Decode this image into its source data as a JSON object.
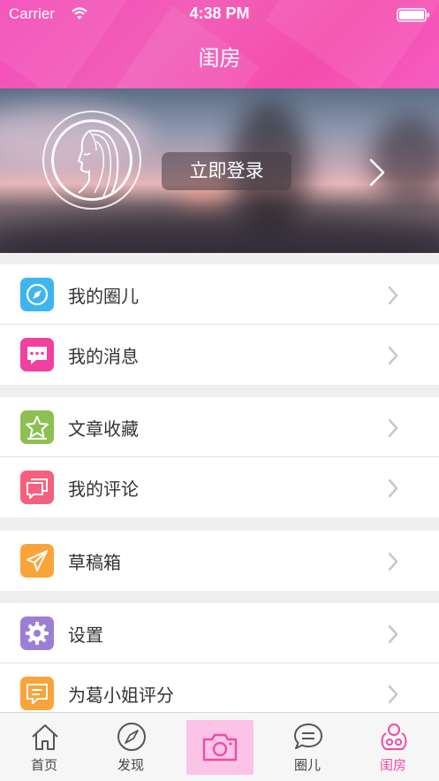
{
  "status_bar": {
    "carrier": "Carrier",
    "time": "4:38 PM"
  },
  "header": {
    "title": "闺房"
  },
  "profile": {
    "login_label": "立即登录"
  },
  "menu_groups": [
    {
      "items": [
        {
          "label": "我的圈儿",
          "icon": "compass-icon",
          "color": "#3fb5f0"
        },
        {
          "label": "我的消息",
          "icon": "message-icon",
          "color": "#f2409e"
        }
      ]
    },
    {
      "items": [
        {
          "label": "文章收藏",
          "icon": "star-icon",
          "color": "#8cc152"
        },
        {
          "label": "我的评论",
          "icon": "comment-icon",
          "color": "#f6607e"
        }
      ]
    },
    {
      "items": [
        {
          "label": "草稿箱",
          "icon": "paper-plane-icon",
          "color": "#f9a43a"
        }
      ]
    },
    {
      "items": [
        {
          "label": "设置",
          "icon": "gear-icon",
          "color": "#9b7fd6"
        },
        {
          "label": "为葛小姐评分",
          "icon": "rating-icon",
          "color": "#f9a43a"
        }
      ]
    }
  ],
  "tabbar": {
    "tabs": [
      {
        "label": "首页",
        "icon": "home-icon"
      },
      {
        "label": "发现",
        "icon": "compass-icon"
      },
      {
        "label": "",
        "icon": "camera-icon"
      },
      {
        "label": "圈儿",
        "icon": "chat-icon"
      },
      {
        "label": "闺房",
        "icon": "boudoir-icon",
        "active": true
      }
    ]
  },
  "colors": {
    "accent": "#f04ba8",
    "header": "#f44bb7"
  }
}
